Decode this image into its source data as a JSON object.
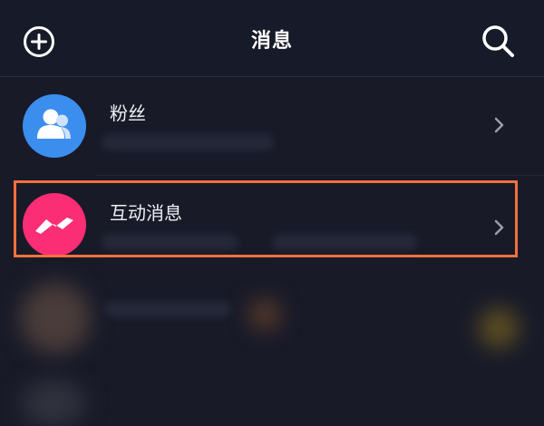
{
  "header": {
    "title": "消息",
    "add_icon": "plus-circle-icon",
    "search_icon": "search-icon"
  },
  "list": {
    "items": [
      {
        "label": "粉丝",
        "icon": "fans-group-icon",
        "avatar_color": "#3b8eed"
      },
      {
        "label": "互动消息",
        "icon": "interaction-wave-icon",
        "avatar_color": "#fb2d74"
      }
    ]
  },
  "highlight": {
    "color": "#f2703e"
  }
}
